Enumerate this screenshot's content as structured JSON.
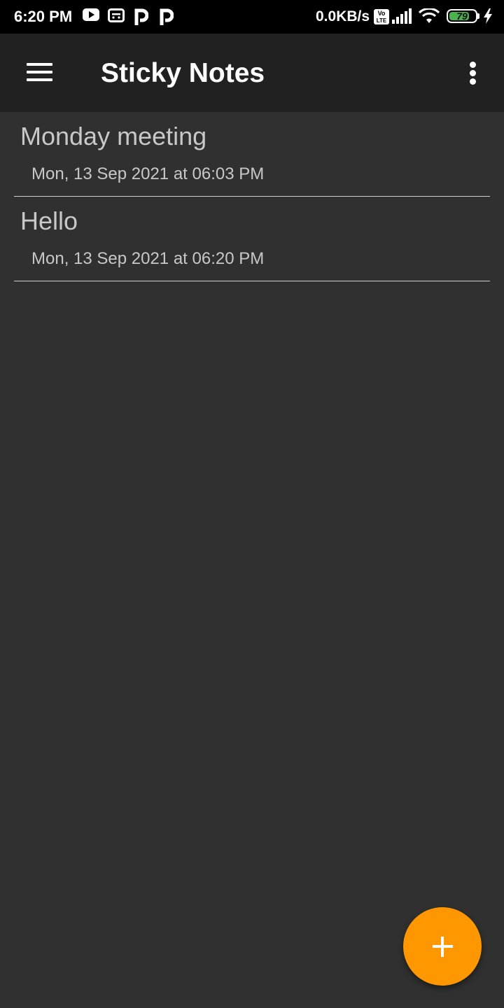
{
  "status_bar": {
    "time": "6:20 PM",
    "network_speed": "0.0KB/s",
    "volte_top": "Vo",
    "volte_bottom": "LTE",
    "battery_level": "79",
    "battery_color": "#4caf50",
    "notification_icons": [
      "youtube-icon",
      "screen-recorder-icon",
      "p-app-icon",
      "p-app-icon"
    ]
  },
  "app_bar": {
    "title": "Sticky Notes",
    "background": "#212121"
  },
  "notes": [
    {
      "title": "Monday meeting",
      "date": "Mon, 13 Sep 2021 at 06:03 PM"
    },
    {
      "title": "Hello",
      "date": "Mon, 13 Sep 2021 at 06:20 PM"
    }
  ],
  "fab": {
    "icon": "plus-icon",
    "color": "#ff9800"
  },
  "theme": {
    "background": "#303030",
    "text_color": "#c8c8c8"
  }
}
